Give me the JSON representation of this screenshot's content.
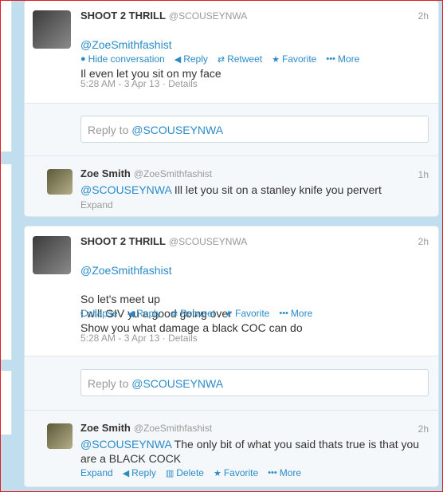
{
  "conversation1": {
    "tweet": {
      "name": "SHOOT 2 THRILL",
      "handle": "@SCOUSEYNWA",
      "time": "2h",
      "mention": "@ZoeSmithfashist",
      "text": "Il even let you sit on my face",
      "actions": {
        "toggle": "Hide conversation",
        "reply": "Reply",
        "retweet": "Retweet",
        "favorite": "Favorite",
        "more": "More"
      },
      "timestamp": "5:28 AM - 3 Apr 13",
      "details": "Details"
    },
    "reply_placeholder": {
      "prefix": "Reply to ",
      "mention": "@SCOUSEYNWA"
    },
    "reply": {
      "name": "Zoe Smith",
      "handle": "@ZoeSmithfashist",
      "time": "1h",
      "mention": "@SCOUSEYNWA",
      "text": " Ill let you sit on a stanley knife you pervert",
      "expand": "Expand"
    }
  },
  "conversation2": {
    "tweet": {
      "name": "SHOOT 2 THRILL",
      "handle": "@SCOUSEYNWA",
      "time": "2h",
      "mention": "@ZoeSmithfashist",
      "text": "So let's meet up\nI will GIV yu a good going over\nShow you what damage a black COC can do",
      "actions": {
        "toggle": "Collapse",
        "reply": "Reply",
        "retweet": "Retweet",
        "favorite": "Favorite",
        "more": "More"
      },
      "timestamp": "5:28 AM - 3 Apr 13",
      "details": "Details"
    },
    "reply_placeholder": {
      "prefix": "Reply to ",
      "mention": "@SCOUSEYNWA"
    },
    "reply": {
      "name": "Zoe Smith",
      "handle": "@ZoeSmithfashist",
      "time": "2h",
      "mention": "@SCOUSEYNWA",
      "text": " The only bit of what you said thats true is that you are a BLACK COCK",
      "actions": {
        "expand": "Expand",
        "reply": "Reply",
        "delete": "Delete",
        "favorite": "Favorite",
        "more": "More"
      }
    }
  }
}
